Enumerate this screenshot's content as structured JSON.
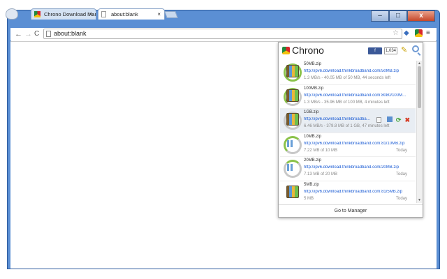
{
  "tabs": [
    {
      "label": "Chrono Download Mar"
    },
    {
      "label": "about:blank"
    }
  ],
  "tab_close": "×",
  "address": "about:blank",
  "popup": {
    "title": "Chrono",
    "fb_label": "f",
    "fb_count": "1,034",
    "footer": "Go to Manager",
    "items": [
      {
        "name": "50MB.zip",
        "url": "http://ipv6.download.thinkbroadband.com/50MB.zip",
        "status": "1.3 MB/s - 40.05 MB of 50 MB, 44 seconds left",
        "when": ""
      },
      {
        "name": "100MB.zip",
        "url": "http://ipv6.download.thinkbroadband.com:8080/100M...",
        "status": "1.3 MB/s - 35.96 MB of 100 MB, 4 minutes left",
        "when": ""
      },
      {
        "name": "1GB.zip",
        "url": "http://ipv6.download.thinkbroadba...",
        "status": "6.46 MB/s - 379.8 MB of 1 GB, 47 minutes left",
        "when": ""
      },
      {
        "name": "10MB.zip",
        "url": "http://ipv6.download.thinkbroadband.com:81/10MB.zip",
        "status": "7.22 MB of 10 MB",
        "when": "Today"
      },
      {
        "name": "20MB.zip",
        "url": "http://ipv6.download.thinkbroadband.com/20MB.zip",
        "status": "7.13 MB of 20 MB",
        "when": "Today"
      },
      {
        "name": "5MB.zip",
        "url": "http://ipv6.download.thinkbroadband.com:81/5MB.zip",
        "status": "5 MB",
        "when": "Today"
      }
    ]
  }
}
